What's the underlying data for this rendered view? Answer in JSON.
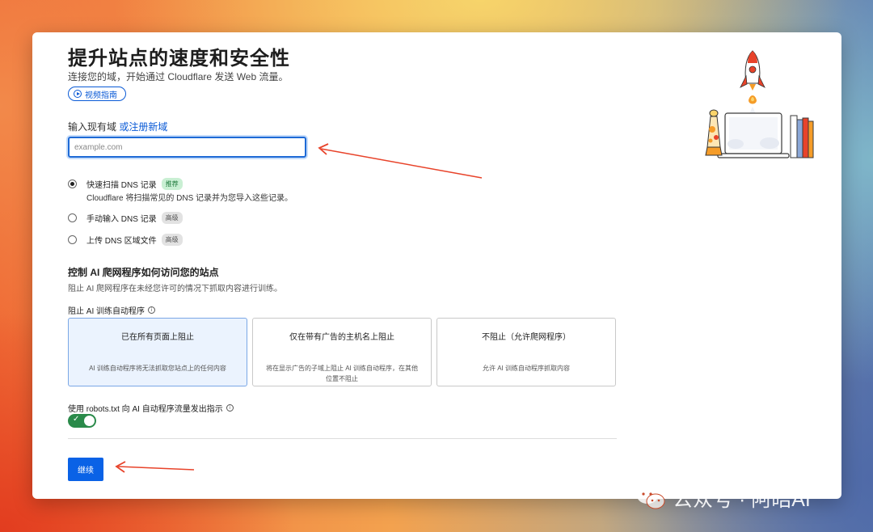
{
  "page": {
    "title": "提升站点的速度和安全性",
    "subtitle": "连接您的域，开始通过 Cloudflare 发送 Web 流量。",
    "video_guide_label": "视频指南"
  },
  "domain": {
    "label": "输入现有域",
    "register_link": "或注册新域",
    "placeholder": "example.com",
    "value": ""
  },
  "dns_options": [
    {
      "label": "快速扫描 DNS 记录",
      "tag": "推荐",
      "selected": true,
      "description": "Cloudflare 将扫描常见的 DNS 记录并为您导入这些记录。"
    },
    {
      "label": "手动输入 DNS 记录",
      "tag": "高级",
      "selected": false
    },
    {
      "label": "上传 DNS 区域文件",
      "tag": "高级",
      "selected": false
    }
  ],
  "ai": {
    "heading": "控制 AI 爬网程序如何访问您的站点",
    "subheading": "阻止 AI 爬网程序在未经您许可的情况下抓取内容进行训练。",
    "block_label": "阻止 AI 训练自动程序",
    "options": [
      {
        "title": "已在所有页面上阻止",
        "desc": "AI 训练自动程序将无法抓取您站点上的任何内容",
        "selected": true
      },
      {
        "title": "仅在带有广告的主机名上阻止",
        "desc": "将在显示广告的子域上阻止 AI 训练自动程序，在其他位置不阻止",
        "selected": false
      },
      {
        "title": "不阻止（允许爬网程序）",
        "desc": "允许 AI 训练自动程序抓取内容",
        "selected": false
      }
    ],
    "robots_label": "使用 robots.txt 向 AI 自动程序流量发出指示",
    "robots_enabled": true
  },
  "continue_label": "继续",
  "watermark": "公众号 · 阿皓AI",
  "colors": {
    "accent": "#0a62e6",
    "link": "#0a5ad6",
    "toggle_on": "#2a8a4a",
    "annotation_arrow": "#e8432a"
  }
}
